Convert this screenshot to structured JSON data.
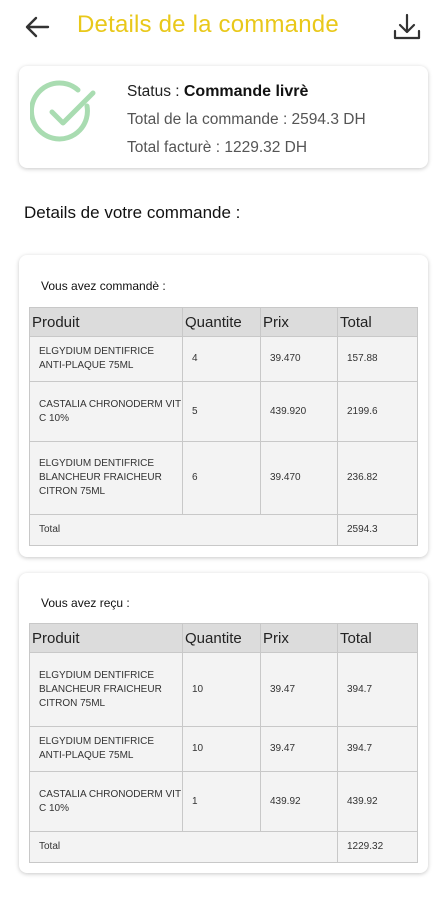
{
  "header": {
    "title": "Details de la commande"
  },
  "status": {
    "status_label": "Status : ",
    "status_value": "Commande livrè",
    "total_line": "Total de la commande : 2594.3 DH",
    "billed_line": "Total facturè : 1229.32 DH"
  },
  "section_title": "Details de votre commande :",
  "columns": [
    "Produit",
    "Quantite",
    "Prix",
    "Total"
  ],
  "ordered": {
    "caption": "Vous avez commandè :",
    "rows": [
      [
        "ELGYDIUM DENTIFRICE ANTI-PLAQUE 75ML",
        "4",
        "39.470",
        "157.88"
      ],
      [
        "CASTALIA CHRONODERM VIT C 10%",
        "5",
        "439.920",
        "2199.6"
      ],
      [
        "ELGYDIUM DENTIFRICE BLANCHEUR FRAICHEUR CITRON 75ML",
        "6",
        "39.470",
        "236.82"
      ]
    ],
    "total_label": "Total",
    "total_value": "2594.3"
  },
  "received": {
    "caption": "Vous avez reçu :",
    "rows": [
      [
        "ELGYDIUM DENTIFRICE BLANCHEUR FRAICHEUR CITRON 75ML",
        "10",
        "39.47",
        "394.7"
      ],
      [
        "ELGYDIUM DENTIFRICE ANTI-PLAQUE 75ML",
        "10",
        "39.47",
        "394.7"
      ],
      [
        "CASTALIA CHRONODERM VIT C 10%",
        "1",
        "439.92",
        "439.92"
      ]
    ],
    "total_label": "Total",
    "total_value": "1229.32"
  },
  "icons": {
    "back": "arrow-left-icon",
    "download": "download-icon",
    "status": "check-circle-icon"
  },
  "colors": {
    "title": "#e9c81a",
    "check": "#a9dcb1"
  }
}
